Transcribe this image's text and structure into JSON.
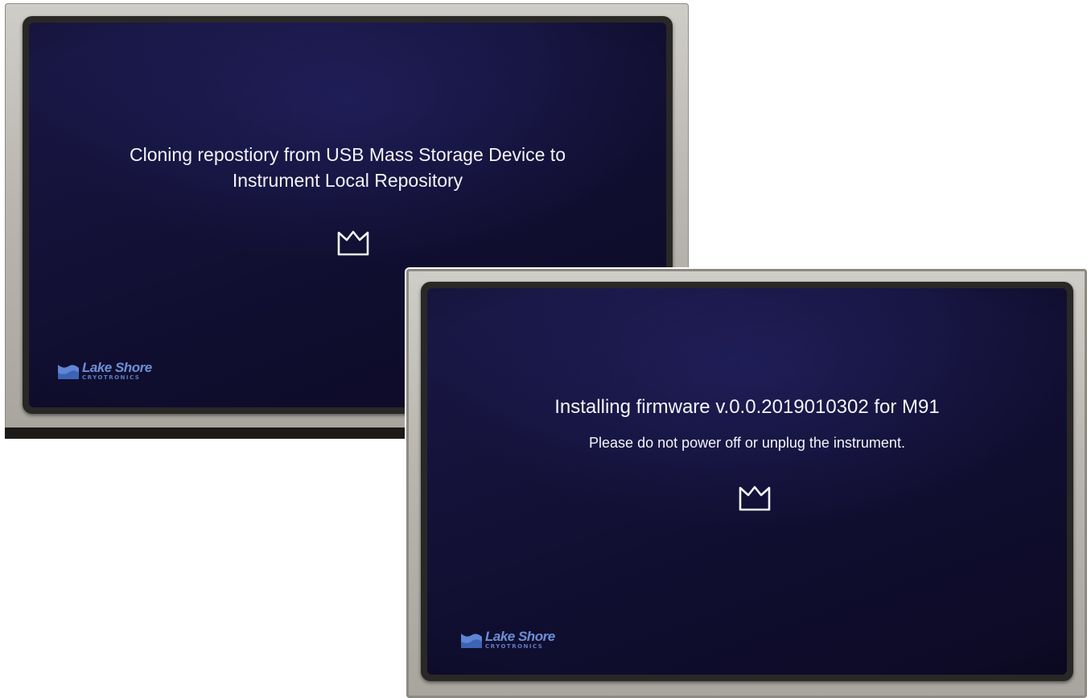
{
  "screens": [
    {
      "title_line1": "Cloning repostiory from USB Mass Storage Device to",
      "title_line2": "Instrument Local Repository",
      "busy_icon": "lake-shore-busy-icon",
      "logo": {
        "name": "Lake Shore",
        "tagline": "CRYOTRONICS"
      }
    },
    {
      "title": "Installing firmware v.0.0.2019010302 for M91",
      "subtitle": "Please do not power off or unplug the instrument.",
      "busy_icon": "lake-shore-busy-icon",
      "logo": {
        "name": "Lake Shore",
        "tagline": "CRYOTRONICS"
      }
    }
  ],
  "colors": {
    "screen_background": "#141238",
    "text": "#f4f4f8",
    "logo_blue": "#6c8fd6",
    "bezel": "#2a2826",
    "frame": "#bdbab3"
  }
}
